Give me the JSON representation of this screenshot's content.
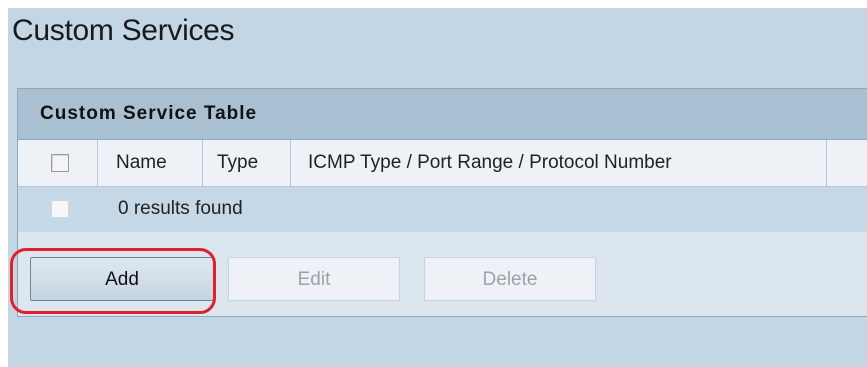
{
  "page": {
    "title": "Custom Services"
  },
  "table": {
    "title": "Custom Service Table",
    "columns": [
      "Name",
      "Type",
      "ICMP Type / Port Range / Protocol Number"
    ],
    "empty_message": "0 results found"
  },
  "buttons": {
    "add": "Add",
    "edit": "Edit",
    "delete": "Delete"
  },
  "annotation": {
    "highlight_color": "#e0202a",
    "highlighted": "add-button"
  }
}
